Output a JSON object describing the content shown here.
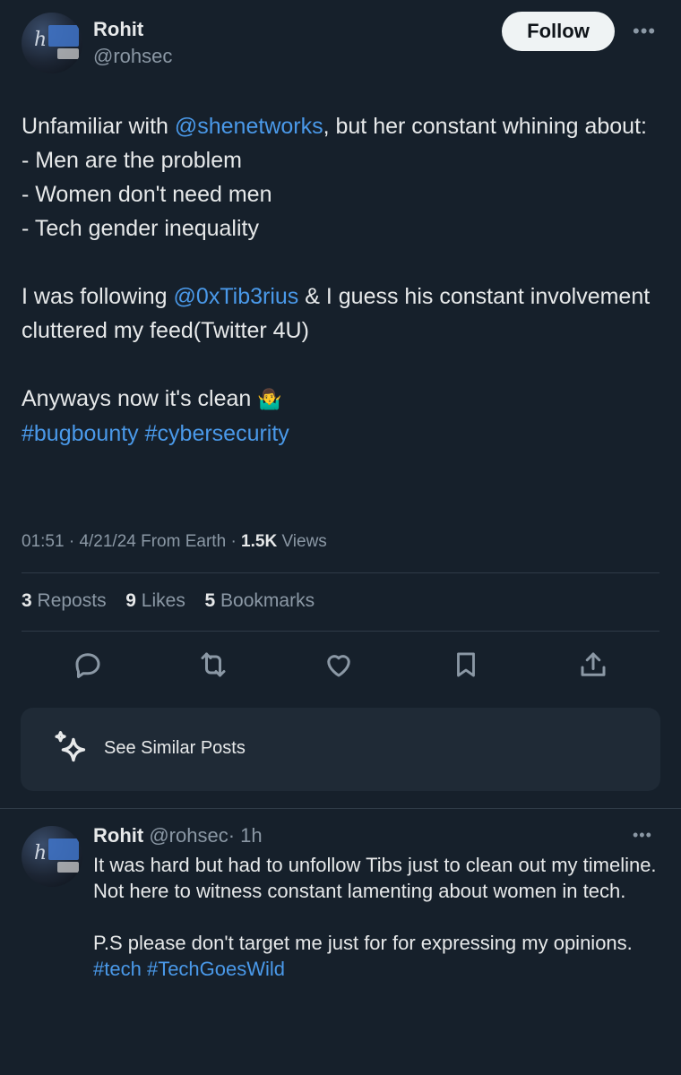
{
  "post": {
    "author_name": "Rohit",
    "author_handle": "@rohsec",
    "follow_label": "Follow",
    "more_label": "•••",
    "text_1": "Unfamiliar with ",
    "mention_1": "@shenetworks",
    "text_2": ", but her constant whining about:\n- Men are the problem\n- Women don't need men\n- Tech gender inequality\n\nI was following ",
    "mention_2": "@0xTib3rius",
    "text_3": " & I guess his constant involvement cluttered my feed(Twitter 4U)\n\nAnyways now it's clean ",
    "emoji": "🤷‍♂️",
    "hashtag_1": "#bugbounty",
    "hashtag_2": "#cybersecurity",
    "time": "01:51",
    "date": "4/21/24",
    "location": "From Earth",
    "views_count": "1.5K",
    "views_label": "Views",
    "sep": "·"
  },
  "stats": {
    "reposts_count": "3",
    "reposts_label": "Reposts",
    "likes_count": "9",
    "likes_label": "Likes",
    "bookmarks_count": "5",
    "bookmarks_label": "Bookmarks"
  },
  "actions": {
    "icons": [
      "reply-icon",
      "repost-icon",
      "like-icon",
      "bookmark-icon",
      "share-icon"
    ]
  },
  "similar": {
    "label": "See Similar Posts",
    "icon": "sparkle-icon"
  },
  "reply": {
    "author_name": "Rohit",
    "author_handle": "@rohsec",
    "time": "· 1h",
    "more_label": "•••",
    "text": "It was hard but had to unfollow Tibs just to clean out my timeline.\nNot here to witness constant lamenting about women in tech.\n\nP.S please don't target me just for for expressing my opinions.",
    "hashtag_1": "#tech",
    "hashtag_2": "#TechGoesWild"
  },
  "colors": {
    "background": "#16202b",
    "link": "#4a99e9",
    "secondary_text": "#8b98a5",
    "primary_text": "#e7e9ea"
  }
}
